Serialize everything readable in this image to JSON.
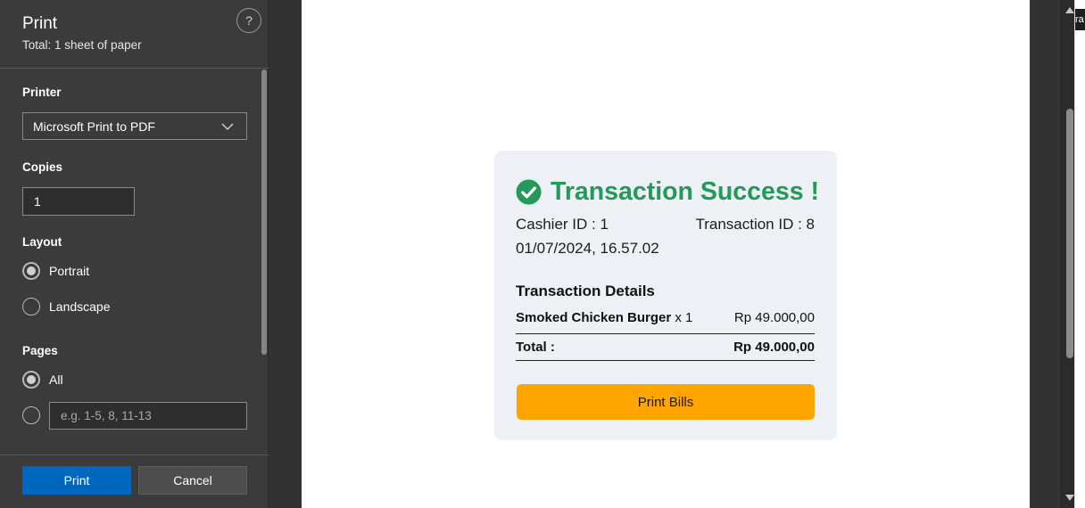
{
  "print_panel": {
    "title": "Print",
    "subtitle": "Total: 1 sheet of paper",
    "help_label": "?",
    "printer_label": "Printer",
    "printer_value": "Microsoft Print to PDF",
    "copies_label": "Copies",
    "copies_value": "1",
    "layout_label": "Layout",
    "layout_options": [
      "Portrait",
      "Landscape"
    ],
    "layout_selected": "Portrait",
    "pages_label": "Pages",
    "pages_all_label": "All",
    "pages_placeholder": "e.g. 1-5, 8, 11-13",
    "print_button": "Print",
    "cancel_button": "Cancel"
  },
  "receipt": {
    "headline": "Transaction Success !",
    "cashier": "Cashier ID : 1",
    "transaction": "Transaction ID : 8",
    "datetime": "01/07/2024, 16.57.02",
    "details_title": "Transaction Details",
    "item_name": "Smoked Chicken Burger",
    "item_qty": " x 1",
    "item_price": "Rp 49.000,00",
    "total_label": "Total :",
    "total_value": "Rp 49.000,00",
    "print_bills_button": "Print Bills"
  },
  "edge_tab_text": "ra",
  "colors": {
    "accent_blue": "#0067c0",
    "success_green": "#23995a",
    "button_orange": "#ffa500"
  }
}
